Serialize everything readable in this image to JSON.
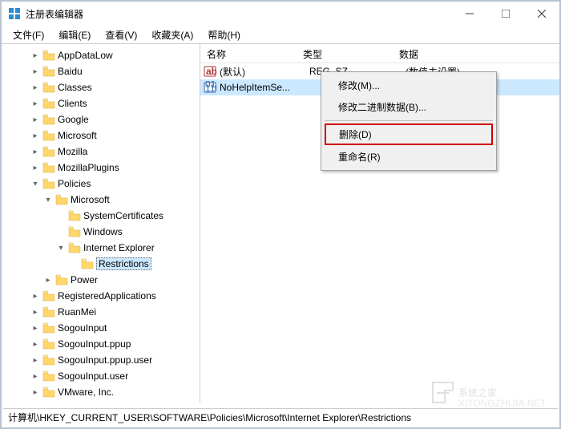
{
  "window": {
    "title": "注册表编辑器"
  },
  "menus": {
    "file": "文件(F)",
    "edit": "编辑(E)",
    "view": "查看(V)",
    "favorites": "收藏夹(A)",
    "help": "帮助(H)"
  },
  "columns": {
    "name": "名称",
    "type": "类型",
    "data": "数据"
  },
  "rows": [
    {
      "icon": "str",
      "name": "(默认)",
      "type": "REG_SZ",
      "data": "(数值未设置)",
      "selected": false
    },
    {
      "icon": "bin",
      "name": "NoHelpItemSe...",
      "type": "",
      "data": ")",
      "selected": true
    }
  ],
  "contextMenu": {
    "modify": "修改(M)...",
    "modifyBinary": "修改二进制数据(B)...",
    "delete": "删除(D)",
    "rename": "重命名(R)"
  },
  "tree": [
    {
      "indent": 2,
      "exp": ">",
      "label": "AppDataLow"
    },
    {
      "indent": 2,
      "exp": ">",
      "label": "Baidu"
    },
    {
      "indent": 2,
      "exp": ">",
      "label": "Classes"
    },
    {
      "indent": 2,
      "exp": ">",
      "label": "Clients"
    },
    {
      "indent": 2,
      "exp": ">",
      "label": "Google"
    },
    {
      "indent": 2,
      "exp": ">",
      "label": "Microsoft"
    },
    {
      "indent": 2,
      "exp": ">",
      "label": "Mozilla"
    },
    {
      "indent": 2,
      "exp": ">",
      "label": "MozillaPlugins"
    },
    {
      "indent": 2,
      "exp": "v",
      "label": "Policies"
    },
    {
      "indent": 3,
      "exp": "v",
      "label": "Microsoft"
    },
    {
      "indent": 4,
      "exp": " ",
      "label": "SystemCertificates"
    },
    {
      "indent": 4,
      "exp": " ",
      "label": "Windows"
    },
    {
      "indent": 4,
      "exp": "v",
      "label": "Internet Explorer"
    },
    {
      "indent": 5,
      "exp": " ",
      "label": "Restrictions",
      "selected": true
    },
    {
      "indent": 3,
      "exp": ">",
      "label": "Power"
    },
    {
      "indent": 2,
      "exp": ">",
      "label": "RegisteredApplications"
    },
    {
      "indent": 2,
      "exp": ">",
      "label": "RuanMei"
    },
    {
      "indent": 2,
      "exp": ">",
      "label": "SogouInput"
    },
    {
      "indent": 2,
      "exp": ">",
      "label": "SogouInput.ppup"
    },
    {
      "indent": 2,
      "exp": ">",
      "label": "SogouInput.ppup.user"
    },
    {
      "indent": 2,
      "exp": ">",
      "label": "SogouInput.user"
    },
    {
      "indent": 2,
      "exp": ">",
      "label": "VMware, Inc."
    }
  ],
  "status": {
    "path": "计算机\\HKEY_CURRENT_USER\\SOFTWARE\\Policies\\Microsoft\\Internet Explorer\\Restrictions"
  },
  "watermark": "系统之家"
}
